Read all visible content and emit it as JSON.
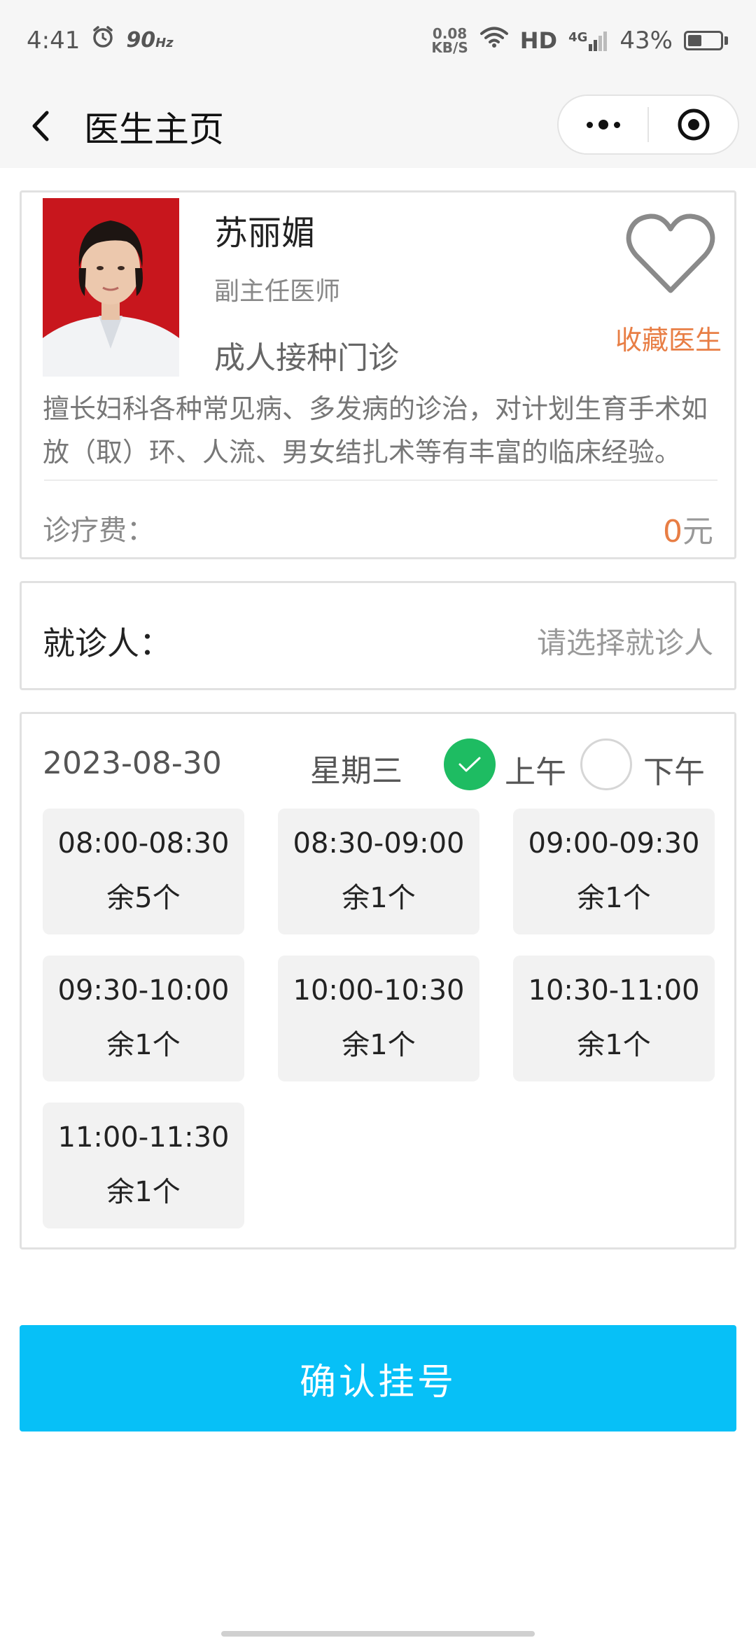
{
  "status_bar": {
    "time": "4:41",
    "refresh_rate": "90",
    "refresh_unit": "Hz",
    "speed_value": "0.08",
    "speed_unit": "KB/S",
    "hd": "HD",
    "network": "4G",
    "battery": "43%",
    "battery_level": 0.43
  },
  "nav": {
    "title": "医生主页"
  },
  "doctor": {
    "name": "苏丽媚",
    "title": "副主任医师",
    "department": "成人接种门诊",
    "favorite_label": "收藏医生",
    "description": "擅长妇科各种常见病、多发病的诊治，对计划生育手术如放（取）环、人流、男女结扎术等有丰富的临床经验。",
    "fee_label": "诊疗费：",
    "fee_value": "0",
    "fee_unit": "元"
  },
  "patient": {
    "label": "就诊人：",
    "placeholder": "请选择就诊人"
  },
  "schedule": {
    "date": "2023-08-30",
    "weekday": "星期三",
    "am_label": "上午",
    "pm_label": "下午",
    "am_selected": true,
    "slots": [
      {
        "time": "08:00-08:30",
        "remain": "余5个"
      },
      {
        "time": "08:30-09:00",
        "remain": "余1个"
      },
      {
        "time": "09:00-09:30",
        "remain": "余1个"
      },
      {
        "time": "09:30-10:00",
        "remain": "余1个"
      },
      {
        "time": "10:00-10:30",
        "remain": "余1个"
      },
      {
        "time": "10:30-11:00",
        "remain": "余1个"
      },
      {
        "time": "11:00-11:30",
        "remain": "余1个"
      }
    ]
  },
  "confirm_button": "确认挂号",
  "colors": {
    "accent_orange": "#e87e45",
    "confirm_blue": "#07c0f7",
    "check_green": "#1ebc62"
  }
}
